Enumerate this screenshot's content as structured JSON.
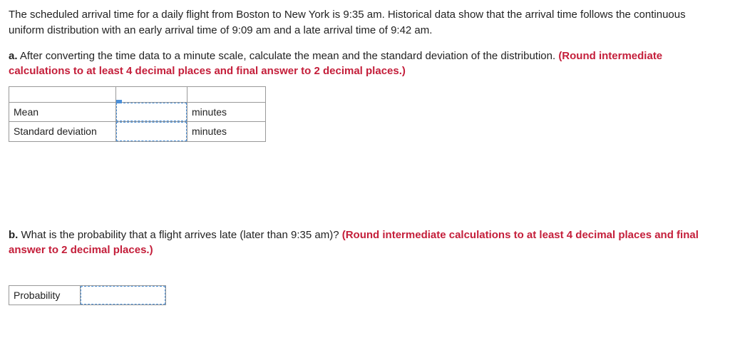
{
  "intro": "The scheduled arrival time for a daily flight from Boston to New York is 9:35 am. Historical data show that the arrival time follows the continuous uniform distribution with an early arrival time of 9:09 am and a late arrival time of 9:42 am.",
  "partA": {
    "label": "a.",
    "question": " After converting the time data to a minute scale, calculate the mean and the standard deviation of the distribution. ",
    "instruction": "(Round intermediate calculations to at least 4 decimal places and final answer to 2 decimal places.)",
    "rows": {
      "mean": {
        "label": "Mean",
        "unit": "minutes"
      },
      "sd": {
        "label": "Standard deviation",
        "unit": "minutes"
      }
    }
  },
  "partB": {
    "label": "b.",
    "question": " What is the probability that a flight arrives late (later than 9:35 am)? ",
    "instruction": "(Round intermediate calculations to at least 4 decimal places and final answer to 2 decimal places.)",
    "rows": {
      "prob": {
        "label": "Probability"
      }
    }
  }
}
